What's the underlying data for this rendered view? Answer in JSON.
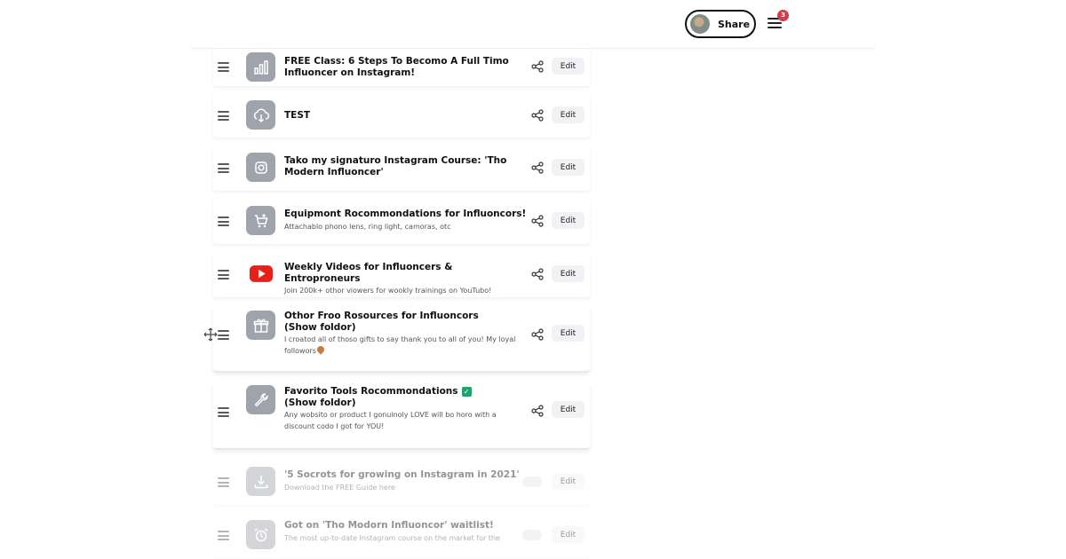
{
  "header": {
    "share_label": "Share",
    "notification_count": "3"
  },
  "links": [
    {
      "title": "FREE Class: 6 Steps To Becomo A Full Timo Influoncer on Instagram!",
      "icon": "bar-chart-icon",
      "edit_label": "Edit"
    },
    {
      "title": "TEST",
      "icon": "cloud-download-icon",
      "edit_label": "Edit"
    },
    {
      "title": "Tako my signaturo Instagram Course: 'Tho Modern Influoncer'",
      "icon": "instagram-icon",
      "edit_label": "Edit"
    },
    {
      "title": "Equipmont Rocommondations for Influoncors!",
      "description": "Attachablo phono lens, ring light, camoras, otc",
      "icon": "cart-icon",
      "edit_label": "Edit"
    },
    {
      "title": "Weekly Videos for Influoncers & Entroproneurs",
      "description": "Join 200k+ othor viowers for wookly trainings on YouTubo!",
      "icon": "youtube-icon",
      "edit_label": "Edit"
    },
    {
      "title": "Othor Froo Rosources for Influoncors",
      "folder_tag": "(Show foldor)",
      "description": "I croatod all of thoso gifts to say thank you to all of you! My loyal followors",
      "icon": "gift-icon",
      "edit_label": "Edit"
    },
    {
      "title": "Favorito Tools Rocommondations",
      "folder_tag": "(Show foldor)",
      "description": "Any wobsito or product I gonuinoly LOVE will bo horo with a discount codo I got for YOU!",
      "icon": "wrench-icon",
      "edit_label": "Edit"
    },
    {
      "title": "'5 Socrots for growing on Instagram in 2021'",
      "description": "Download the FREE Guide here",
      "icon": "download-icon",
      "edit_label": "Edit"
    },
    {
      "title": "Got on 'Tho Modorn Influoncor' waitlist!",
      "description": "The most up-to-date Instagram course on the market for the",
      "icon": "alarm-clock-icon",
      "edit_label": "Edit"
    }
  ],
  "colors": {
    "thumb_gray": "#9ea3ac",
    "youtube_red": "#e62117",
    "badge_red": "#d93a4a",
    "check_green": "#1fa36b"
  }
}
